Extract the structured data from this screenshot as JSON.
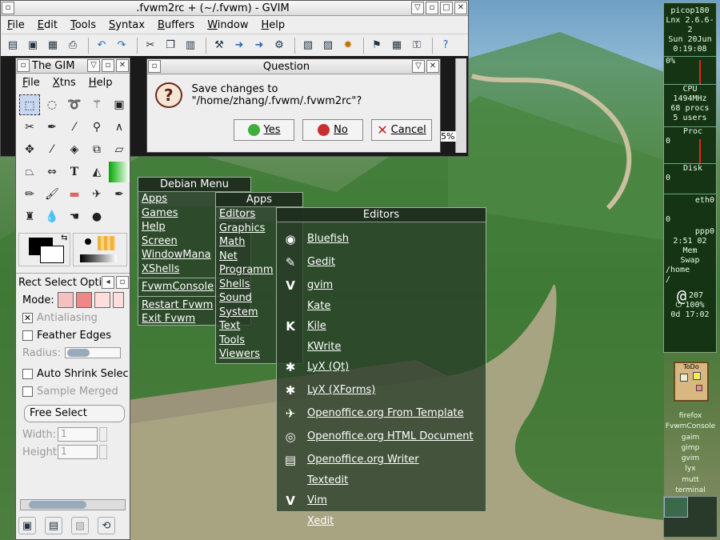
{
  "gvim": {
    "title": ".fvwm2rc + (~/.fvwm) - GVIM",
    "menu": [
      "File",
      "Edit",
      "Tools",
      "Syntax",
      "Buffers",
      "Window",
      "Help"
    ],
    "percent": "5%"
  },
  "dialog": {
    "title": "Question",
    "message": "Save changes to \"/home/zhang/.fvwm/.fvwm2rc\"?",
    "yes": "Yes",
    "no": "No",
    "cancel": "Cancel"
  },
  "gimp": {
    "title": "The GIM",
    "menu": [
      "File",
      "Xtns",
      "Help"
    ],
    "panel_title": "Rect Select Opti",
    "mode_label": "Mode:",
    "antialiasing": "Antialiasing",
    "feather": "Feather Edges",
    "radius": "Radius:",
    "auto_shrink": "Auto Shrink Selec",
    "sample_merged": "Sample Merged",
    "select_mode": "Free Select",
    "width_label": "Width:",
    "width_val": "1",
    "height_label": "Height:",
    "height_val": "1"
  },
  "debian_menu": {
    "title": "Debian Menu",
    "items": [
      "Apps",
      "Games",
      "Help",
      "Screen",
      "WindowMana",
      "XShells"
    ],
    "items2": [
      "FvwmConsole"
    ],
    "items3": [
      "Restart Fvwm",
      "Exit Fvwm"
    ]
  },
  "apps_menu": {
    "title": "Apps",
    "items": [
      "Editors",
      "Graphics",
      "Math",
      "Net",
      "Programm",
      "Shells",
      "Sound",
      "System",
      "Text",
      "Tools",
      "Viewers"
    ]
  },
  "editors_menu": {
    "title": "Editors",
    "items": [
      {
        "label": "Bluefish",
        "icon": "bluefish-icon",
        "glyph": "◉"
      },
      {
        "label": "Gedit",
        "icon": "gedit-icon",
        "glyph": "✎"
      },
      {
        "label": "gvim",
        "icon": "vim-icon",
        "glyph": "V"
      },
      {
        "label": "Kate",
        "icon": "",
        "glyph": ""
      },
      {
        "label": "Kile",
        "icon": "kile-icon",
        "glyph": "K"
      },
      {
        "label": "KWrite",
        "icon": "",
        "glyph": ""
      },
      {
        "label": "LyX (Qt)",
        "icon": "lyx-icon",
        "glyph": "✱"
      },
      {
        "label": "LyX (XForms)",
        "icon": "lyx-icon",
        "glyph": "✱"
      },
      {
        "label": "Openoffice.org From Template",
        "icon": "ooo-icon",
        "glyph": "✈"
      },
      {
        "label": "Openoffice.org HTML Document",
        "icon": "ooo-html-icon",
        "glyph": "◎"
      },
      {
        "label": "Openoffice.org Writer",
        "icon": "ooo-writer-icon",
        "glyph": "▤"
      },
      {
        "label": "Textedit",
        "icon": "",
        "glyph": ""
      },
      {
        "label": "Vim",
        "icon": "vim-icon",
        "glyph": "V"
      },
      {
        "label": "Xedit",
        "icon": "",
        "glyph": ""
      }
    ]
  },
  "pager": {
    "host": "picop180",
    "kernel": "Lnx 2.6.6-2",
    "date": "Sun 20Jun",
    "time": "0:19:08",
    "cpu_pct": "0%",
    "cpu": "CPU",
    "mhz": "1494MHz",
    "procs": "68 procs",
    "users": "5 users",
    "proc": "Proc",
    "zero1": "0",
    "disk": "Disk",
    "zero2": "0",
    "eth": "eth0",
    "zero3": "0",
    "ppp": "ppp0",
    "ppp_time": "2:51 02",
    "mem": "Mem",
    "swap": "Swap",
    "home": "/home",
    "root": "/",
    "mail": "207",
    "battery": "100%",
    "uptime": "0d 17:02"
  },
  "todo": "ToDo",
  "window_list": [
    "firefox",
    "FvwmConsole",
    "gaim",
    "gimp",
    "gvim",
    "lyx",
    "mutt",
    "terminal"
  ]
}
